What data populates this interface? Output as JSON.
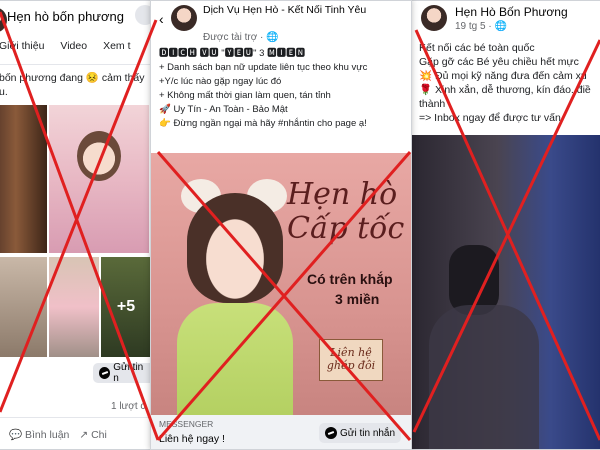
{
  "panel1": {
    "page_name": "Hẹn hò bốn phương",
    "tabs": [
      "Giới thiệu",
      "Video",
      "Xem t"
    ],
    "post_text": "bốn phương đang 😣 cảm thấy",
    "post_text_2": "u.",
    "photo_more_count": "+5",
    "send_message": "Gửi tin n",
    "shares": "1 lượt c",
    "comment": "Bình luận",
    "share": "Chi"
  },
  "panel2": {
    "page_name": "Dịch Vụ Hẹn Hò - Kết Nối Tinh Yêu",
    "sponsored": "Được tài trợ · 🌐",
    "lines": [
      "🅳🅸🅲🅷 🆅🆄 \"🆈🅴🆄\" 3 🅼🅸🅴🅽",
      "+ Danh sách bạn nữ update liên tục theo khu vực",
      "+Y/c lúc nào gặp ngay lúc đó",
      "+ Không mất thời gian làm quen, tán tỉnh",
      "🚀 Uy Tín - An Toàn - Bảo Mật",
      "👉 Đừng ngần ngại mà hãy #nhắntin cho page ạ!"
    ],
    "ad_title_1": "Hẹn hò",
    "ad_title_2": "Cấp tốc",
    "ad_sub_1": "Có trên khắp",
    "ad_sub_2": "3 miền",
    "ad_cta_1": "Liên hệ",
    "ad_cta_2": "ghép đôi",
    "messenger": "MESSENGER",
    "contact": "Liên hệ ngay !",
    "send_message": "Gửi tin nhắn"
  },
  "panel3": {
    "page_name": "Hẹn Hò Bốn Phương",
    "date": "19 tg 5 · 🌐",
    "lines": [
      "Kết nối các bé toàn quốc",
      "Gặp gỡ các Bé yêu chiều hết mực",
      "💥 Đủ mọi kỹ năng đưa đến cảm xú",
      "🌹 Xinh xắn, dễ thương, kín đáo. điề",
      "thành",
      "=> Inbox ngay để được tư vấn"
    ]
  },
  "colors": {
    "x_mark": "#e02020",
    "link": "#385898"
  }
}
